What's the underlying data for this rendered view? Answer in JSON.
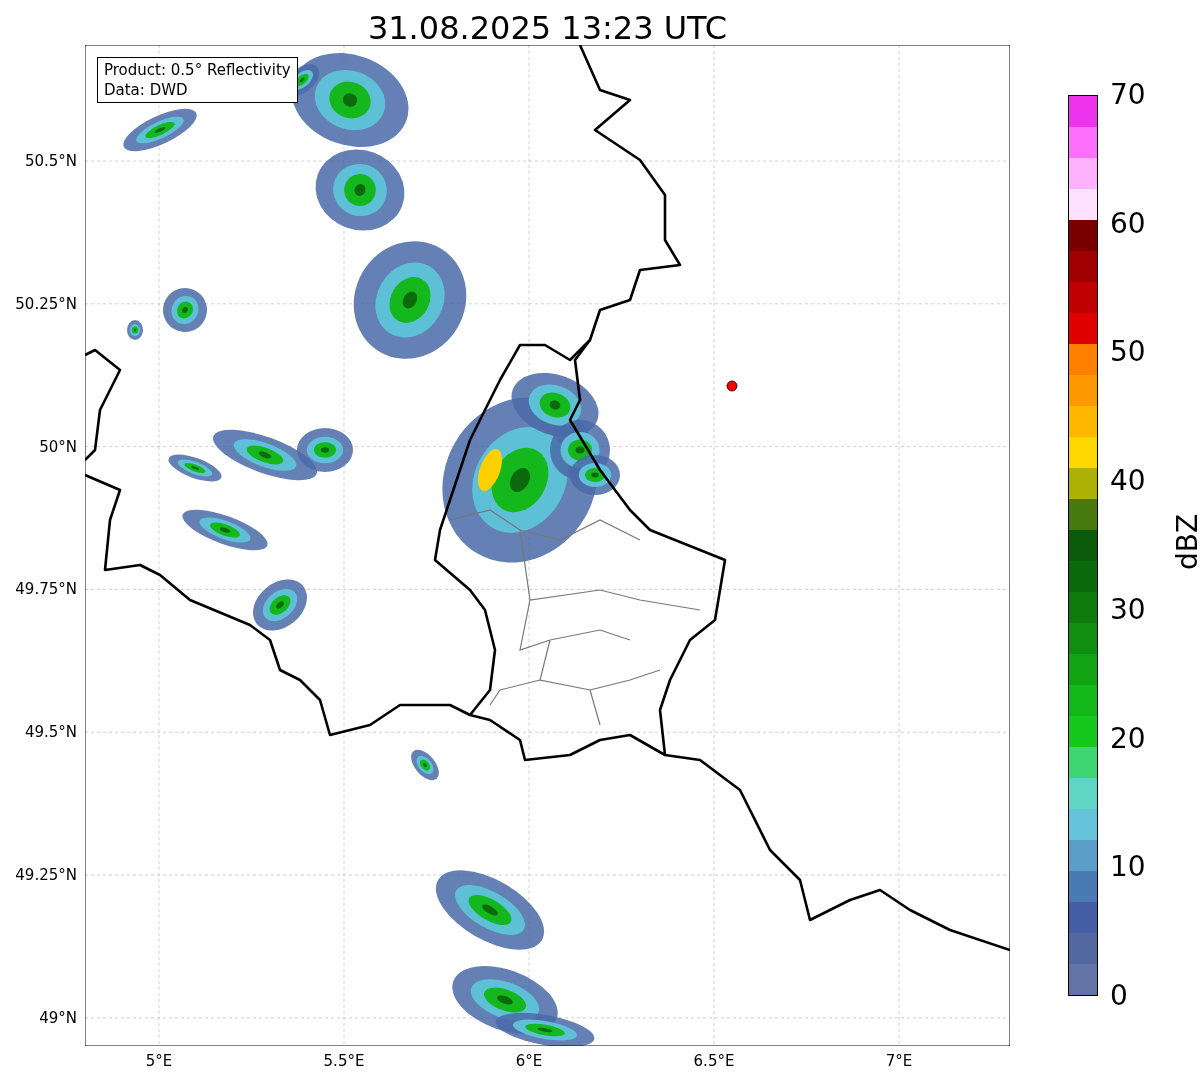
{
  "title": "31.08.2025 13:23 UTC",
  "info_box": {
    "lines": [
      "Product: 0.5° Reflectivity",
      "Data: DWD"
    ]
  },
  "map": {
    "lat_ticks": [
      "50.5°N",
      "50.25°N",
      "50°N",
      "49.75°N",
      "49.5°N",
      "49.25°N",
      "49°N"
    ],
    "lon_ticks": [
      "5°E",
      "5.5°E",
      "6°E",
      "6.5°E",
      "7°E"
    ]
  },
  "colorbar": {
    "label": "dBZ",
    "ticks": [
      "70",
      "60",
      "50",
      "40",
      "30",
      "20",
      "10",
      "0"
    ],
    "bins": [
      {
        "color": "#ee33ee"
      },
      {
        "color": "#ff70ff"
      },
      {
        "color": "#ffb3ff"
      },
      {
        "color": "#ffe0ff"
      },
      {
        "color": "#7a0000"
      },
      {
        "color": "#a00000"
      },
      {
        "color": "#c00000"
      },
      {
        "color": "#e00000"
      },
      {
        "color": "#ff7f00"
      },
      {
        "color": "#ff9900"
      },
      {
        "color": "#ffb800"
      },
      {
        "color": "#ffd700"
      },
      {
        "color": "#adb106"
      },
      {
        "color": "#467a0c"
      },
      {
        "color": "#0a5c0a"
      },
      {
        "color": "#0b6a0c"
      },
      {
        "color": "#0e7a0e"
      },
      {
        "color": "#0f8e10"
      },
      {
        "color": "#10a412"
      },
      {
        "color": "#12b818"
      },
      {
        "color": "#14c81c"
      },
      {
        "color": "#3dd672"
      },
      {
        "color": "#5fd6c4"
      },
      {
        "color": "#66c3dc"
      },
      {
        "color": "#5a9dc6"
      },
      {
        "color": "#4a7ab2"
      },
      {
        "color": "#445ea5"
      },
      {
        "color": "#5468a0"
      },
      {
        "color": "#6474a6"
      }
    ]
  }
}
